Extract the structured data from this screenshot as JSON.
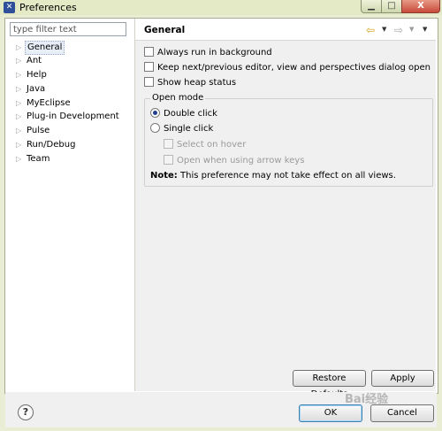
{
  "window": {
    "title": "Preferences",
    "icon": "eclipse-icon"
  },
  "titlebar_buttons": {
    "minimize": "▁",
    "maximize": "□",
    "close": "X"
  },
  "filter": {
    "placeholder": "type filter text",
    "value": ""
  },
  "tree": {
    "items": [
      {
        "label": "General",
        "selected": true
      },
      {
        "label": "Ant"
      },
      {
        "label": "Help"
      },
      {
        "label": "Java"
      },
      {
        "label": "MyEclipse"
      },
      {
        "label": "Plug-in Development"
      },
      {
        "label": "Pulse"
      },
      {
        "label": "Run/Debug"
      },
      {
        "label": "Team"
      }
    ]
  },
  "page": {
    "title": "General",
    "options": [
      {
        "label": "Always run in background",
        "checked": false
      },
      {
        "label": "Keep next/previous editor, view and perspectives dialog open",
        "checked": false
      },
      {
        "label": "Show heap status",
        "checked": false
      }
    ],
    "open_mode": {
      "title": "Open mode",
      "double_click": "Double click",
      "single_click": "Single click",
      "selected": "Double click",
      "select_on_hover": "Select on hover",
      "open_arrow_keys": "Open when using arrow keys"
    },
    "note_label": "Note:",
    "note_text": " This preference may not take effect on all views."
  },
  "buttons": {
    "restore_defaults": "Restore Defaults",
    "apply": "Apply",
    "ok": "OK",
    "cancel": "Cancel"
  },
  "help": "?",
  "watermark": "Bai经验"
}
